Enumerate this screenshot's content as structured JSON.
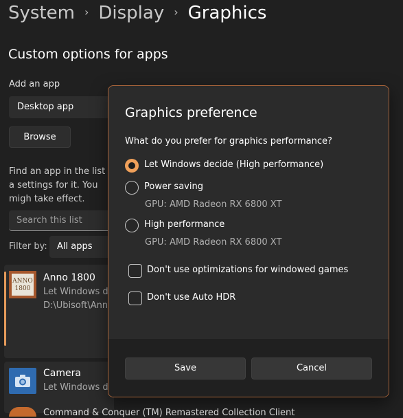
{
  "breadcrumb": {
    "items": [
      "System",
      "Display",
      "Graphics"
    ]
  },
  "section_title": "Custom options for apps",
  "add_app": {
    "label": "Add an app",
    "dropdown_value": "Desktop app",
    "browse_label": "Browse"
  },
  "find_text": "Find an app in the list a settings for it. You migh take effect.",
  "search": {
    "placeholder": "Search this list"
  },
  "filter": {
    "label": "Filter by:",
    "value": "All apps"
  },
  "apps": [
    {
      "name": "Anno 1800",
      "subtitle": "Let Windows de",
      "path": "D:\\Ubisoft\\Anno",
      "icon": "anno-icon",
      "icon_text": "ANNO 1800"
    },
    {
      "name": "Camera",
      "subtitle": "Let Windows de",
      "icon": "camera-icon"
    },
    {
      "name": "Command & Conquer (TM) Remastered Collection Client",
      "icon": "game-icon"
    }
  ],
  "dialog": {
    "title": "Graphics preference",
    "question": "What do you prefer for graphics performance?",
    "options": [
      {
        "label": "Let Windows decide (High performance)",
        "selected": true
      },
      {
        "label": "Power saving",
        "gpu": "GPU: AMD Radeon RX 6800 XT",
        "selected": false
      },
      {
        "label": "High performance",
        "gpu": "GPU: AMD Radeon RX 6800 XT",
        "selected": false
      }
    ],
    "checkboxes": [
      {
        "label": "Don't use optimizations for windowed games",
        "checked": false
      },
      {
        "label": "Don't use Auto HDR",
        "checked": false
      }
    ],
    "save_label": "Save",
    "cancel_label": "Cancel"
  },
  "colors": {
    "accent": "#f0a05a",
    "background": "#202020",
    "dialog_bg": "#2b2b2b",
    "dialog_border": "#a8643a"
  }
}
